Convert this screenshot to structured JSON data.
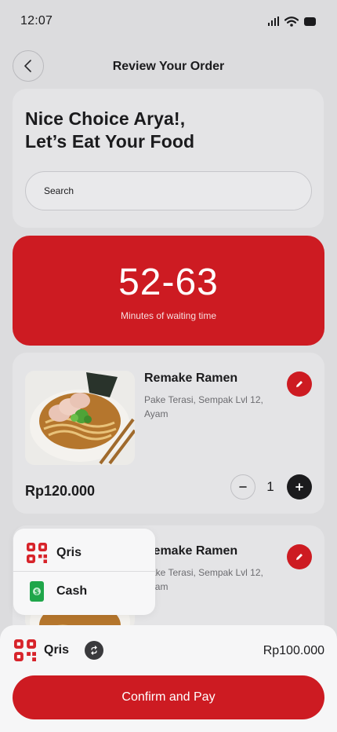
{
  "status": {
    "time": "12:07"
  },
  "header": {
    "title": "Review Your Order"
  },
  "greeting": {
    "line1": "Nice Choice Arya!,",
    "line2": "Let’s Eat Your Food"
  },
  "search": {
    "placeholder": "Search"
  },
  "wait": {
    "range": "52-63",
    "label": "Minutes of waiting time"
  },
  "items": [
    {
      "name": "Remake Ramen",
      "desc": "Pake Terasi, Sempak Lvl 12, Ayam",
      "price": "Rp120.000",
      "qty": "1"
    },
    {
      "name": "Remake Ramen",
      "desc": "Pake Terasi, Sempak Lvl 12, Ayam"
    }
  ],
  "payment_menu": {
    "options": [
      "Qris",
      "Cash"
    ]
  },
  "bottom": {
    "method": "Qris",
    "total": "Rp100.000",
    "confirm_label": "Confirm and Pay"
  },
  "colors": {
    "accent": "#cd1b22",
    "background": "#dcdcde",
    "card": "#e4e4e6",
    "dark": "#1b1b1d"
  },
  "icons": [
    "back-arrow-icon",
    "signal-icon",
    "wifi-icon",
    "battery-icon",
    "edit-pencil-icon",
    "minus-icon",
    "plus-icon",
    "qris-icon",
    "cash-icon",
    "switch-icon"
  ]
}
